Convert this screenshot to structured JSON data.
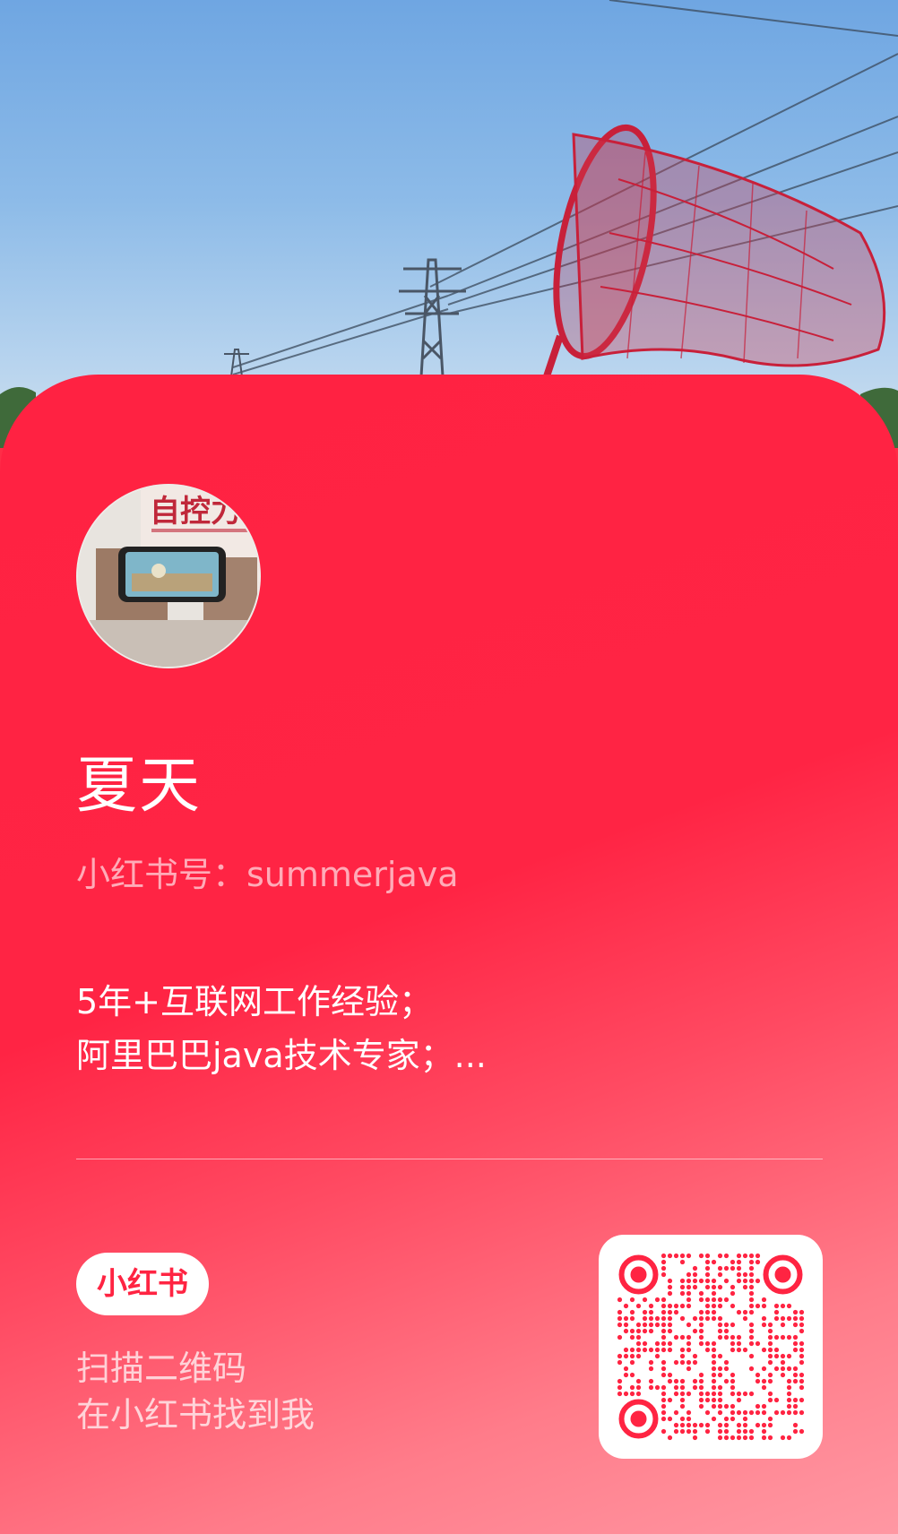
{
  "profile": {
    "nickname": "夏天",
    "account_id": "小红书号：summerjava",
    "bio_lines": [
      "5年+互联网工作经验；",
      "阿里巴巴java技术专家；..."
    ]
  },
  "brand": {
    "logo_text": "小红书",
    "accent_color": "#ff2442"
  },
  "scan": {
    "line1": "扫描二维码",
    "line2": "在小红书找到我"
  },
  "icons": {
    "avatar": "user-avatar-photo",
    "qr": "qr-code-icon"
  }
}
